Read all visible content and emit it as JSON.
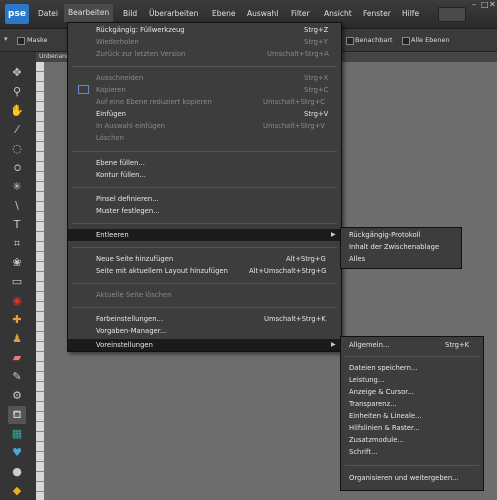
{
  "app": {
    "logo": "pse"
  },
  "menubar": {
    "items": [
      "Datei",
      "Bearbeiten",
      "Bild",
      "Überarbeiten",
      "Ebene",
      "Auswahl",
      "Filter",
      "Ansicht",
      "Fenster",
      "Hilfe"
    ],
    "window_controls": [
      "–",
      "□",
      "✕"
    ]
  },
  "options": {
    "maske": "Maske",
    "behandlung": "Benachbart",
    "alle_ebenen": "Alle Ebenen"
  },
  "document": {
    "tab": "Unbenannt"
  },
  "edit_menu": {
    "items": [
      {
        "label": "Rückgängig: Füllwerkzeug",
        "shortcut": "Strg+Z",
        "disabled": false
      },
      {
        "label": "Wiederholen",
        "shortcut": "Strg+Y",
        "disabled": true
      },
      {
        "label": "Zurück zur letzten Version",
        "shortcut": "Umschalt+Strg+A",
        "disabled": true
      },
      {
        "label": "Ausschneiden",
        "shortcut": "Strg+X",
        "disabled": true
      },
      {
        "label": "Kopieren",
        "shortcut": "Strg+C",
        "disabled": true
      },
      {
        "label": "Auf eine Ebene reduziert kopieren",
        "shortcut": "Umschalt+Strg+C",
        "disabled": true
      },
      {
        "label": "Einfügen",
        "shortcut": "Strg+V",
        "disabled": false
      },
      {
        "label": "In Auswahl einfügen",
        "shortcut": "Umschalt+Strg+V",
        "disabled": true
      },
      {
        "label": "Löschen",
        "shortcut": "",
        "disabled": true
      },
      {
        "label": "Ebene füllen...",
        "shortcut": "",
        "disabled": false
      },
      {
        "label": "Kontur füllen...",
        "shortcut": "",
        "disabled": false
      },
      {
        "label": "Pinsel definieren...",
        "shortcut": "",
        "disabled": false
      },
      {
        "label": "Muster festlegen...",
        "shortcut": "",
        "disabled": false
      },
      {
        "label": "Entleeren",
        "shortcut": "",
        "disabled": false
      },
      {
        "label": "Neue Seite hinzufügen",
        "shortcut": "Alt+Strg+G",
        "disabled": false
      },
      {
        "label": "Seite mit aktuellem Layout hinzufügen",
        "shortcut": "Alt+Umschalt+Strg+G",
        "disabled": false
      },
      {
        "label": "Aktuelle Seite löschen",
        "shortcut": "",
        "disabled": true
      },
      {
        "label": "Farbeinstellungen...",
        "shortcut": "Umschalt+Strg+K",
        "disabled": false
      },
      {
        "label": "Vorgaben-Manager...",
        "shortcut": "",
        "disabled": false
      },
      {
        "label": "Voreinstellungen",
        "shortcut": "",
        "disabled": false
      }
    ]
  },
  "entleeren_submenu": [
    "Rückgängig-Protokoll",
    "Inhalt der Zwischenablage",
    "Alles"
  ],
  "prefs_submenu": {
    "allgemein": "Allgemein...",
    "allgemein_shortcut": "Strg+K",
    "items": [
      "Dateien speichern...",
      "Leistung...",
      "Anzeige & Cursor...",
      "Transparenz...",
      "Einheiten & Lineale...",
      "Hilfslinien & Raster...",
      "Zusatzmodule...",
      "Schrift..."
    ],
    "last": "Organisieren und weitergeben..."
  }
}
